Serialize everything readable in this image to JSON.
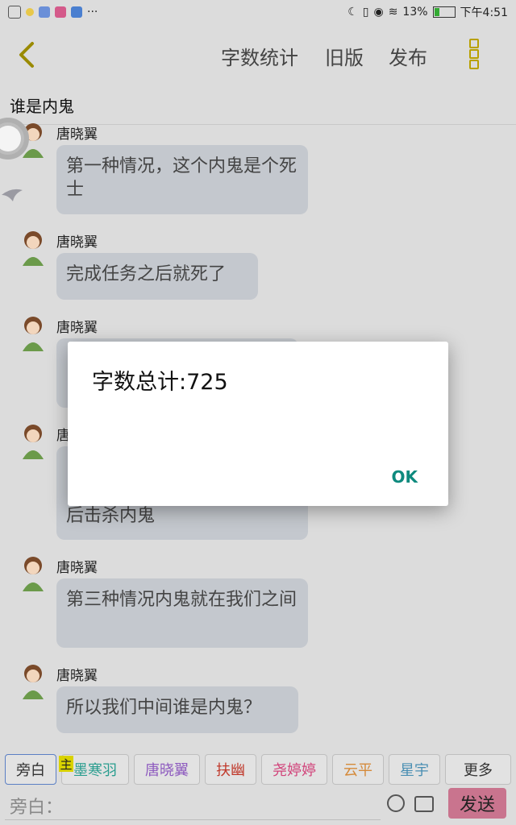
{
  "status_bar": {
    "battery": "13%",
    "time": "下午4:51"
  },
  "toolbar": {
    "word_count": "字数统计",
    "old_version": "旧版",
    "publish": "发布"
  },
  "story_title": "谁是内鬼",
  "messages": [
    {
      "sender": "唐晓翼",
      "text": "第一种情况，这个内鬼是个死士"
    },
    {
      "sender": "唐晓翼",
      "text": "完成任务之后就死了"
    },
    {
      "sender": "唐晓翼",
      "text": ""
    },
    {
      "sender": "唐",
      "text": "后击杀内鬼"
    },
    {
      "sender": "唐晓翼",
      "text": "第三种情况内鬼就在我们之间"
    },
    {
      "sender": "唐晓翼",
      "text": "所以我们中间谁是内鬼？"
    }
  ],
  "dialog": {
    "message": "字数总计:725",
    "ok": "OK"
  },
  "roles": {
    "host_badge": "主",
    "chips": [
      {
        "label": "旁白",
        "color": "#333333"
      },
      {
        "label": "墨寒羽",
        "color": "#2a9d8f"
      },
      {
        "label": "唐晓翼",
        "color": "#8e5bbf"
      },
      {
        "label": "扶幽",
        "color": "#c0392b"
      },
      {
        "label": "尧婷婷",
        "color": "#d1437a"
      },
      {
        "label": "云平",
        "color": "#d58a3a"
      },
      {
        "label": "星宇",
        "color": "#4a8fb3"
      },
      {
        "label": "更多",
        "color": "#333333"
      }
    ]
  },
  "composer": {
    "placeholder": "旁白：",
    "send": "发送"
  }
}
